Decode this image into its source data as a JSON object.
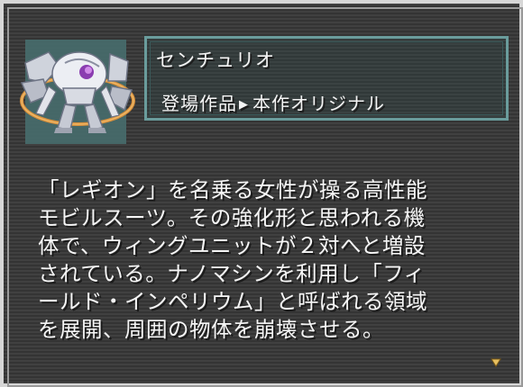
{
  "unit": {
    "name": "センチュリオ",
    "source_label": "登場作品",
    "source_value": "本作オリジナル"
  },
  "description": {
    "lines": [
      "「レギオン」を名乗る女性が操る高性能",
      "モビルスーツ。その強化形と思われる機",
      "体で、ウィングユニットが２対へと増設",
      "されている。ナノマシンを利用し「フィ",
      "ールド・インペリウム」と呼ばれる領域",
      "を展開、周囲の物体を崩壊させる。"
    ]
  },
  "icons": {
    "source_arrow": "right-triangle-icon",
    "advance": "advance-arrow-icon"
  },
  "colors": {
    "panel_border": "#6a9c9c",
    "portrait_bg": "#476d6d",
    "text": "#f4f4f4",
    "advance_arrow": "#e8c060"
  }
}
